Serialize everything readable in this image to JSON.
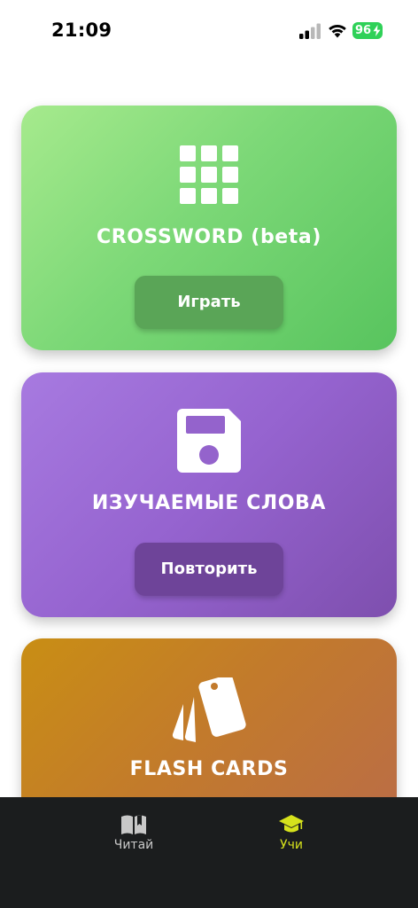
{
  "status_bar": {
    "time": "21:09",
    "battery": "96"
  },
  "cards": {
    "crossword": {
      "icon": "grid-icon",
      "title": "CROSSWORD (beta)",
      "button": "Играть"
    },
    "words": {
      "icon": "floppy-disk-icon",
      "title": "ИЗУЧАЕМЫЕ СЛОВА",
      "button": "Повторить"
    },
    "flash": {
      "icon": "cards-icon",
      "title": "FLASH CARDS"
    }
  },
  "tab_bar": {
    "items": [
      {
        "label": "Читай",
        "icon": "open-book-icon",
        "active": false
      },
      {
        "label": "Учи",
        "icon": "graduation-cap-icon",
        "active": true
      }
    ]
  },
  "colors": {
    "crossword_card": "#7cd877",
    "words_card": "#9563cf",
    "flash_card": "#c27a2c",
    "tab_bar": "#1b1d1e",
    "active_tab": "#d6e21c",
    "battery": "#2fd158"
  }
}
